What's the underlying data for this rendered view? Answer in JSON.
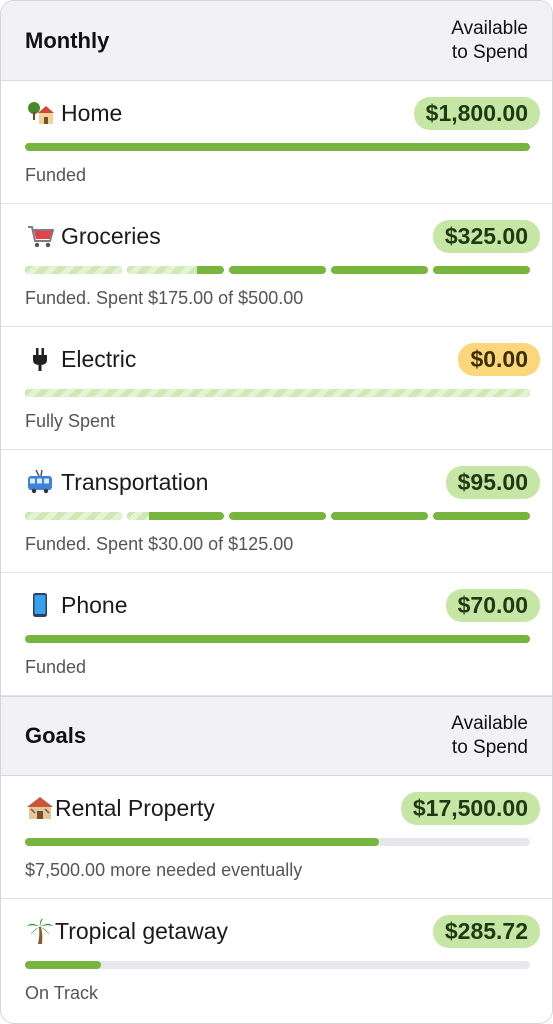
{
  "monthly": {
    "title": "Monthly",
    "available_label_line1": "Available",
    "available_label_line2": "to Spend",
    "items": [
      {
        "emoji": "house-icon",
        "name": "Home",
        "amount": "$1,800.00",
        "status": "Funded",
        "funded_fraction": 1.0,
        "spent_fraction": 0.0,
        "pill_color": "#c6e6a5"
      },
      {
        "emoji": "shopping-cart-icon",
        "name": "Groceries",
        "amount": "$325.00",
        "status": "Funded. Spent $175.00 of $500.00",
        "funded_fraction": 1.0,
        "spent_fraction": 0.35,
        "pill_color": "#c6e6a5"
      },
      {
        "emoji": "plug-icon",
        "name": "Electric",
        "amount": "$0.00",
        "status": "Fully Spent",
        "funded_fraction": 1.0,
        "spent_fraction": 1.0,
        "pill_color": "#fbd77c"
      },
      {
        "emoji": "trolleybus-icon",
        "name": "Transportation",
        "amount": "$95.00",
        "status": "Funded. Spent $30.00 of $125.00",
        "funded_fraction": 1.0,
        "spent_fraction": 0.24,
        "pill_color": "#c6e6a5"
      },
      {
        "emoji": "phone-icon",
        "name": "Phone",
        "amount": "$70.00",
        "status": "Funded",
        "funded_fraction": 1.0,
        "spent_fraction": 0.0,
        "pill_color": "#c6e6a5"
      }
    ]
  },
  "goals": {
    "title": "Goals",
    "available_label_line1": "Available",
    "available_label_line2": "to Spend",
    "items": [
      {
        "emoji": "derelict-house-icon",
        "name": "Rental Property",
        "amount": "$17,500.00",
        "status": "$7,500.00 more needed eventually",
        "progress": 0.7,
        "pill_color": "#c6e6a5"
      },
      {
        "emoji": "palm-tree-icon",
        "name": "Tropical getaway",
        "amount": "$285.72",
        "status": "On Track",
        "progress": 0.15,
        "pill_color": "#c6e6a5"
      }
    ]
  },
  "colors": {
    "accent_green": "#77b53e",
    "hatch_green": "#cfe8b4",
    "pill_green": "#c6e6a5",
    "pill_yellow": "#fbd77c"
  }
}
